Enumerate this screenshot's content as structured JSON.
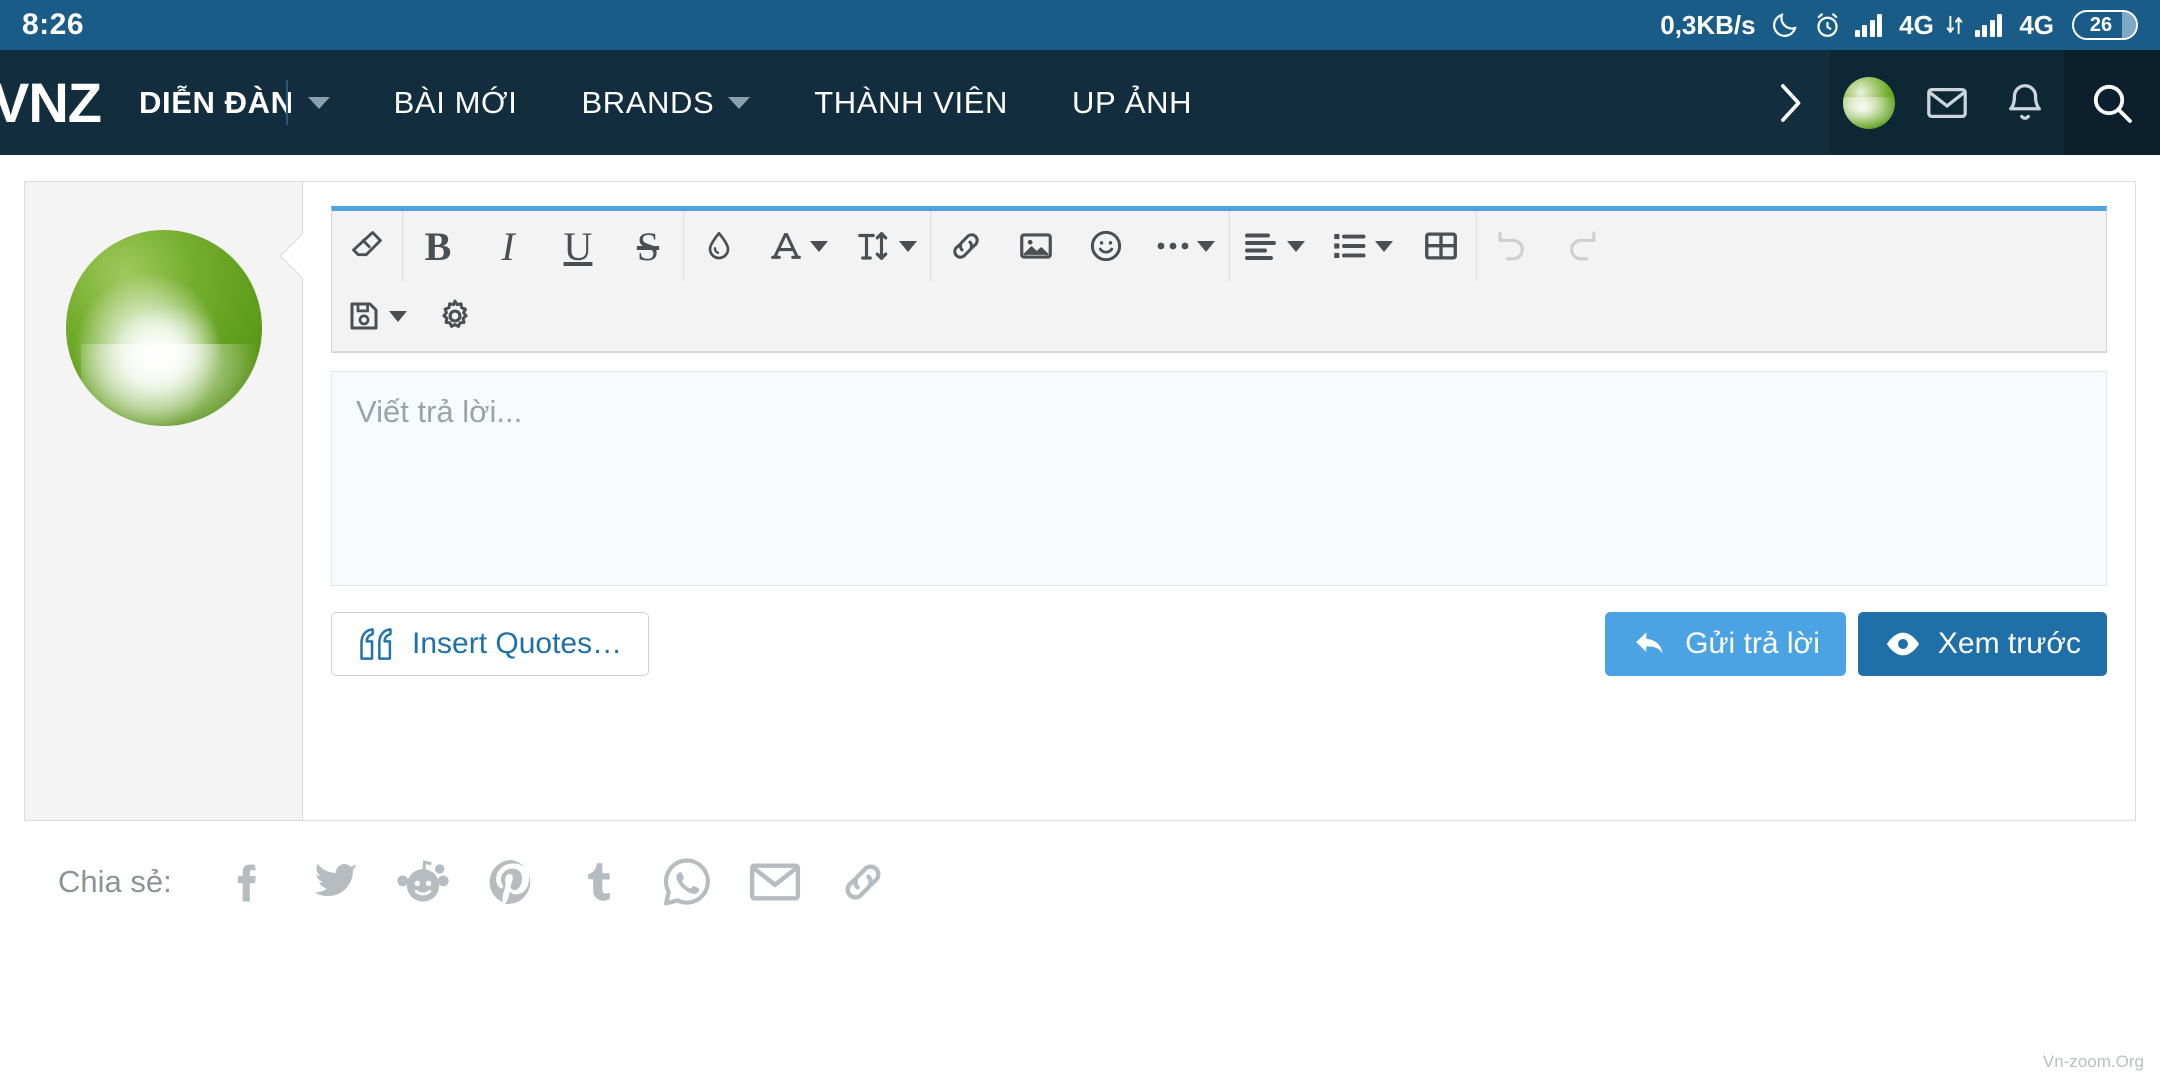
{
  "statusbar": {
    "time": "8:26",
    "network_speed": "0,3KB/s",
    "sim1_label": "4G",
    "sim2_label": "4G",
    "battery_percent": "26",
    "icons": [
      "moon-icon",
      "alarm-clock-icon",
      "signal-bars-icon",
      "data-transfer-icon",
      "signal-bars-icon",
      "battery-icon"
    ],
    "bg_color": "#1a5c88"
  },
  "navbar": {
    "brand": "VNZ",
    "bg_color": "#112d3e",
    "items": [
      {
        "label": "DIỄN ĐÀN",
        "has_caret": true,
        "active": true
      },
      {
        "label": "BÀI MỚI",
        "has_caret": false,
        "active": false
      },
      {
        "label": "BRANDS",
        "has_caret": true,
        "active": false
      },
      {
        "label": "THÀNH VIÊN",
        "has_caret": false,
        "active": false
      },
      {
        "label": "UP ẢNH",
        "has_caret": false,
        "active": false
      }
    ],
    "overflow_icon": "chevron-right-icon",
    "right_icons": [
      "avatar",
      "envelope-icon",
      "bell-icon",
      "search-icon"
    ]
  },
  "editor": {
    "accent_color": "#4ba3e3",
    "toolbar_rows": [
      [
        {
          "name": "remove-formatting-icon",
          "type": "eraser",
          "caret": false,
          "disabled": false
        },
        {
          "name": "bold-button",
          "type": "bold",
          "caret": false,
          "disabled": false
        },
        {
          "name": "italic-button",
          "type": "italic",
          "caret": false,
          "disabled": false
        },
        {
          "name": "underline-button",
          "type": "underline",
          "caret": false,
          "disabled": false
        },
        {
          "name": "strikethrough-button",
          "type": "strike",
          "caret": false,
          "disabled": false
        },
        {
          "name": "text-color-icon",
          "type": "droplet",
          "caret": false,
          "disabled": false
        },
        {
          "name": "font-family-button",
          "type": "font",
          "caret": true,
          "disabled": false
        },
        {
          "name": "font-size-button",
          "type": "fontsize",
          "caret": true,
          "disabled": false
        },
        {
          "name": "link-icon",
          "type": "link",
          "caret": false,
          "disabled": false
        },
        {
          "name": "image-icon",
          "type": "image",
          "caret": false,
          "disabled": false
        },
        {
          "name": "smiley-icon",
          "type": "smiley",
          "caret": false,
          "disabled": false
        },
        {
          "name": "more-options-button",
          "type": "ellipsis",
          "caret": true,
          "disabled": false
        },
        {
          "name": "text-align-button",
          "type": "align",
          "caret": true,
          "disabled": false
        },
        {
          "name": "list-button",
          "type": "list",
          "caret": true,
          "disabled": false
        },
        {
          "name": "table-icon",
          "type": "table",
          "caret": false,
          "disabled": false
        },
        {
          "name": "undo-button",
          "type": "undo",
          "caret": false,
          "disabled": true
        },
        {
          "name": "redo-button",
          "type": "redo",
          "caret": false,
          "disabled": true
        }
      ],
      [
        {
          "name": "save-draft-button",
          "type": "floppy",
          "caret": true,
          "disabled": false
        },
        {
          "name": "editor-settings-icon",
          "type": "gear",
          "caret": false,
          "disabled": false
        }
      ]
    ],
    "reply_placeholder": "Viết trả lời...",
    "reply_value": "",
    "quote_button": "Insert Quotes…",
    "submit_button": "Gửi trả lời",
    "preview_button": "Xem trước"
  },
  "share": {
    "label": "Chia sẻ:",
    "icons": [
      {
        "name": "facebook-icon",
        "glyph": "f"
      },
      {
        "name": "twitter-icon",
        "glyph": "t"
      },
      {
        "name": "reddit-icon",
        "glyph": "r"
      },
      {
        "name": "pinterest-icon",
        "glyph": "p"
      },
      {
        "name": "tumblr-icon",
        "glyph": "u"
      },
      {
        "name": "whatsapp-icon",
        "glyph": "w"
      },
      {
        "name": "email-icon",
        "glyph": "e"
      },
      {
        "name": "link-icon",
        "glyph": "l"
      }
    ]
  },
  "watermark": "Vn-zoom.Org"
}
